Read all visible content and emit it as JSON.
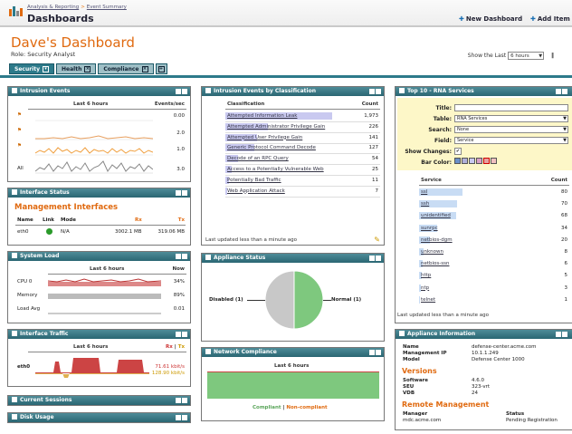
{
  "header": {
    "breadcrumb": [
      "Analysis & Reporting",
      "Event Summary"
    ],
    "title": "Dashboards",
    "actions": [
      "New Dashboard",
      "Add Item"
    ]
  },
  "dashboard": {
    "name": "Dave's Dashboard",
    "role": "Role: Security Analyst",
    "show_last_label": "Show the Last",
    "show_last_value": "6 hours"
  },
  "tabs": [
    "Security",
    "Health",
    "Compliance"
  ],
  "intrusion_events": {
    "title": "Intrusion Events",
    "col1": "Last 6 hours",
    "col2": "Events/sec",
    "rows": [
      {
        "label": "",
        "value": "0.00"
      },
      {
        "label": "",
        "value": "2.0"
      },
      {
        "label": "",
        "value": "1.0"
      },
      {
        "label": "All",
        "value": "3.0"
      }
    ]
  },
  "interface_status": {
    "title": "Interface Status",
    "heading": "Management Interfaces",
    "cols": [
      "Name",
      "Link",
      "Mode",
      "Rx",
      "Tx"
    ],
    "row": {
      "name": "eth0",
      "mode": "N/A",
      "rx": "3002.1 MB",
      "tx": "319.06 MB"
    }
  },
  "system_load": {
    "title": "System Load",
    "col1": "Last 6 hours",
    "col2": "Now",
    "rows": [
      {
        "label": "CPU 0",
        "value": "34%"
      },
      {
        "label": "Memory",
        "value": "89%"
      },
      {
        "label": "Load Avg",
        "value": "0.01"
      }
    ]
  },
  "interface_traffic": {
    "title": "Interface Traffic",
    "col1": "Last 6 hours",
    "col_rx": "Rx",
    "col_tx": "Tx",
    "iface": "eth0",
    "rx": "71.61 kbit/s",
    "tx": "128.90 kbit/s"
  },
  "current_sessions": {
    "title": "Current Sessions"
  },
  "disk_usage": {
    "title": "Disk Usage"
  },
  "by_classification": {
    "title": "Intrusion Events by Classification",
    "col1": "Classification",
    "col2": "Count",
    "rows": [
      {
        "label": "Attempted Information Leak",
        "count": "1,973",
        "frac": 1.0
      },
      {
        "label": "Attempted Administrator Privilege Gain",
        "count": "226",
        "frac": 0.4
      },
      {
        "label": "Attempted User Privilege Gain",
        "count": "141",
        "frac": 0.3
      },
      {
        "label": "Generic Protocol Command Decode",
        "count": "127",
        "frac": 0.27
      },
      {
        "label": "Decode of an RPC Query",
        "count": "54",
        "frac": 0.12
      },
      {
        "label": "Access to a Potentially Vulnerable Web",
        "count": "25",
        "frac": 0.06
      },
      {
        "label": "Potentially Bad Traffic",
        "count": "11",
        "frac": 0.03
      },
      {
        "label": "Web Application Attack",
        "count": "7",
        "frac": 0.02
      }
    ],
    "updated": "Last updated less than a minute ago"
  },
  "appliance_status": {
    "title": "Appliance Status",
    "disabled": "Disabled (1)",
    "normal": "Normal (1)"
  },
  "network_compliance": {
    "title": "Network Compliance",
    "col": "Last 6 hours",
    "compliant": "Compliant",
    "sep": "|",
    "noncompliant": "Non-compliant"
  },
  "rna_services": {
    "title": "Top 10 - RNA Services",
    "form": [
      {
        "label": "Title:",
        "value": ""
      },
      {
        "label": "Table:",
        "value": "RNA Services"
      },
      {
        "label": "Search:",
        "value": "None"
      },
      {
        "label": "Field:",
        "value": "Service"
      }
    ],
    "show_changes": "Show Changes:",
    "bar_color": "Bar Color:",
    "swatches": [
      "#6a8fc8",
      "#b0b0d8",
      "#c9c9f0",
      "#d8a0c8",
      "#e8a0a0",
      "#f0c0c0"
    ],
    "col1": "Service",
    "col2": "Count",
    "rows": [
      {
        "label": "ssl",
        "count": "80",
        "frac": 1.0
      },
      {
        "label": "ssh",
        "count": "70",
        "frac": 0.87
      },
      {
        "label": "unidentified",
        "count": "68",
        "frac": 0.85
      },
      {
        "label": "sunrpc",
        "count": "34",
        "frac": 0.42
      },
      {
        "label": "netbios-dgm",
        "count": "20",
        "frac": 0.25
      },
      {
        "label": "unknown",
        "count": "8",
        "frac": 0.1
      },
      {
        "label": "netbios-ssn",
        "count": "6",
        "frac": 0.08
      },
      {
        "label": "http",
        "count": "5",
        "frac": 0.06
      },
      {
        "label": "ntp",
        "count": "3",
        "frac": 0.04
      },
      {
        "label": "telnet",
        "count": "1",
        "frac": 0.01
      }
    ],
    "updated": "Last updated less than a minute ago"
  },
  "appliance_info": {
    "title": "Appliance Information",
    "fields": [
      {
        "label": "Name",
        "value": "defense-center.acme.com"
      },
      {
        "label": "Management IP",
        "value": "10.1.1.249"
      },
      {
        "label": "Model",
        "value": "Defense Center 1000"
      }
    ],
    "versions_heading": "Versions",
    "versions": [
      {
        "label": "Software",
        "value": "4.6.0"
      },
      {
        "label": "SEU",
        "value": "323-vrt"
      },
      {
        "label": "VDB",
        "value": "24"
      }
    ],
    "remote_heading": "Remote Management",
    "remote_cols": [
      "Manager",
      "Status"
    ],
    "remote_row": {
      "manager": "mdc.acme.com",
      "status": "Pending Registration"
    }
  },
  "colors": {
    "accent": "#e06a10",
    "header_teal": "#2d7a8a",
    "ok_green": "#7ec87e",
    "bad_gray": "#c8c8c8"
  }
}
